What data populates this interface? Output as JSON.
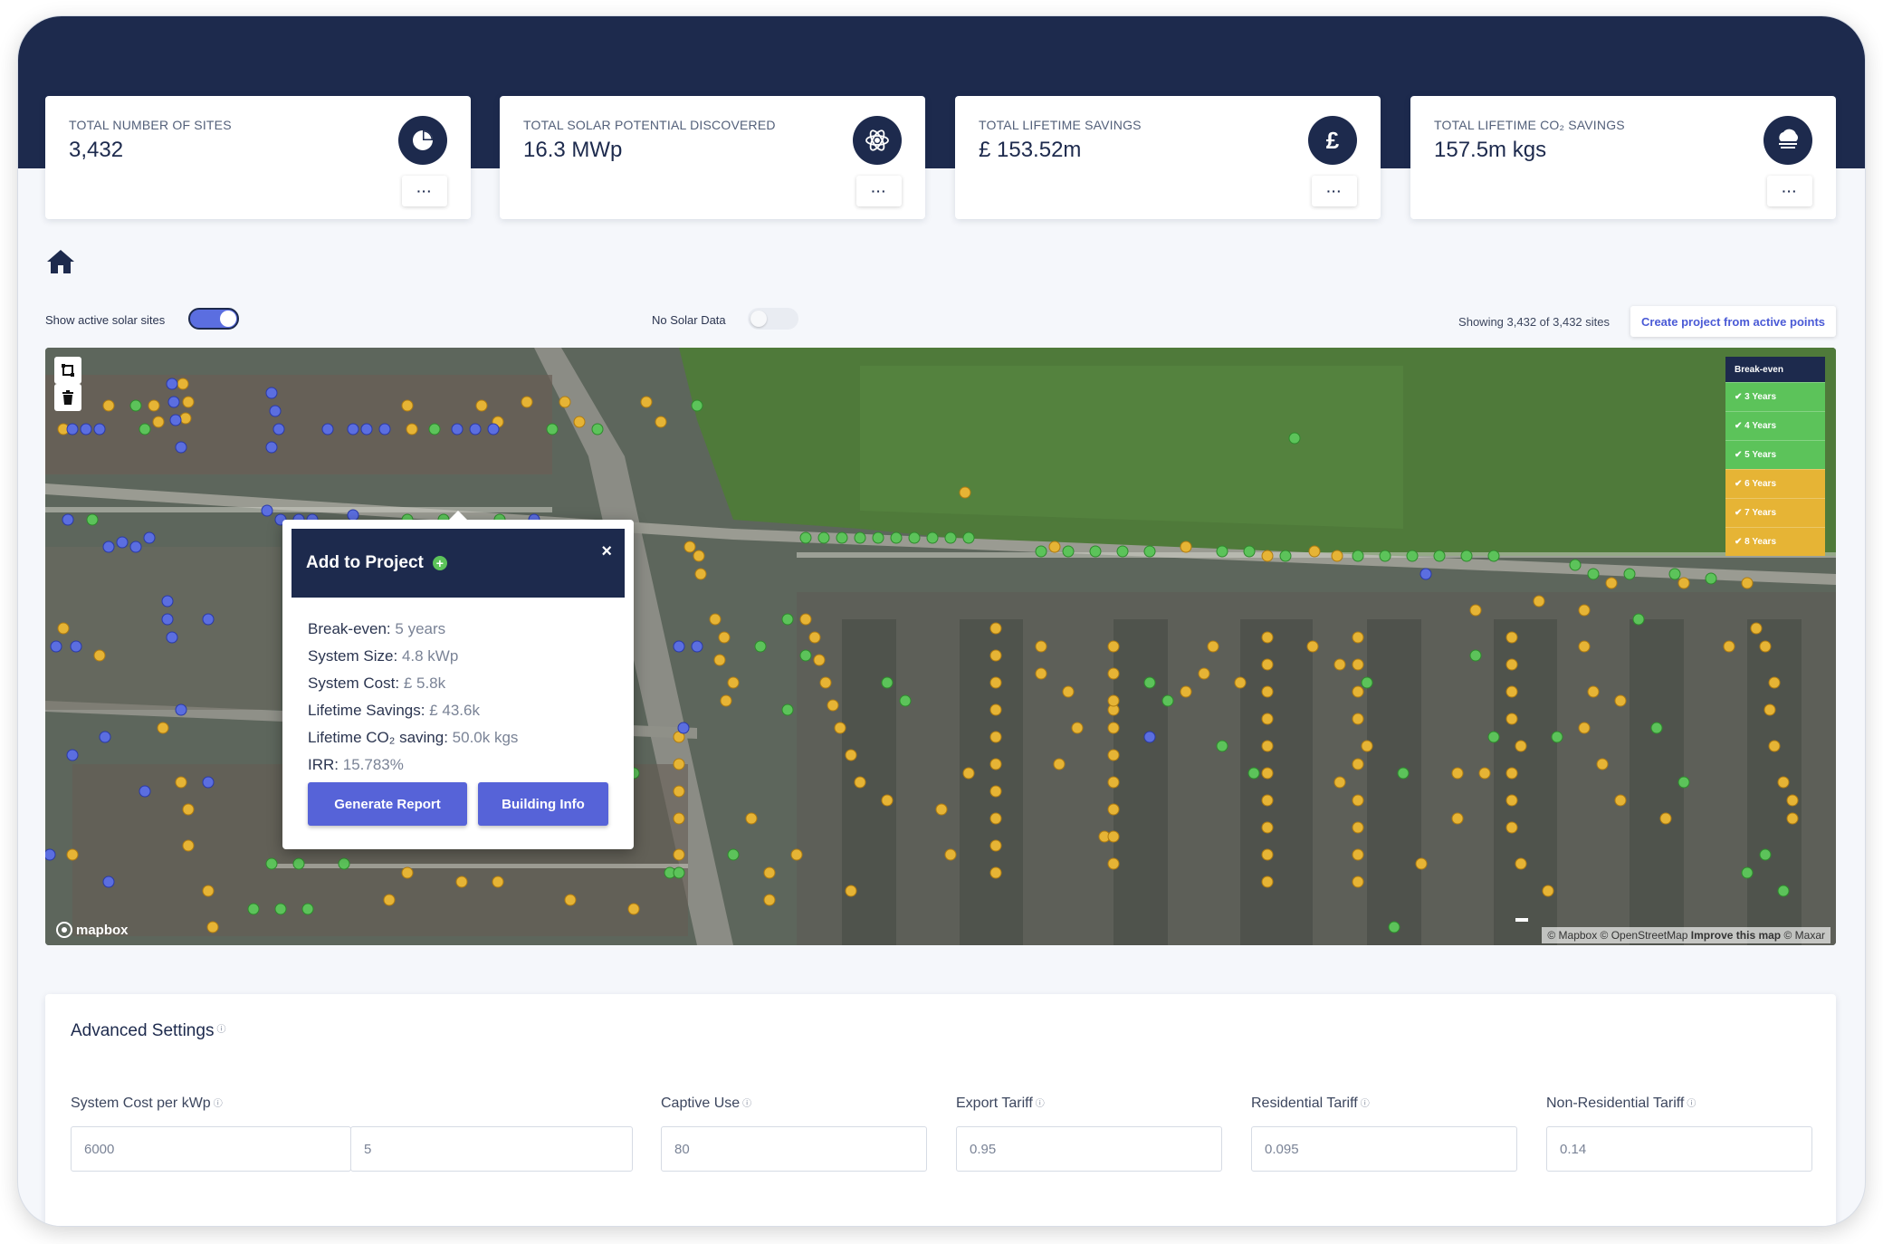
{
  "stats": [
    {
      "label": "TOTAL NUMBER OF SITES",
      "value": "3,432",
      "icon": "pie-chart-icon"
    },
    {
      "label": "TOTAL SOLAR POTENTIAL DISCOVERED",
      "value": "16.3 MWp",
      "icon": "atom-icon"
    },
    {
      "label": "TOTAL LIFETIME SAVINGS",
      "value": "£ 153.52m",
      "icon": "pound-icon",
      "glyph": "£"
    },
    {
      "label": "TOTAL LIFETIME CO₂ SAVINGS",
      "value": "157.5m kgs",
      "icon": "cloud-icon"
    }
  ],
  "more_label": "···",
  "toggles": {
    "active_sites_label": "Show active solar sites",
    "active_sites_on": true,
    "no_solar_label": "No Solar Data",
    "no_solar_on": false
  },
  "showing_text": "Showing 3,432 of 3,432 sites",
  "create_project_label": "Create project from active points",
  "colors": {
    "navy": "#1d2a4d",
    "accent": "#5663d8",
    "green": "#5cc35a",
    "amber": "#e6b435",
    "blue": "#5b6ee0"
  },
  "legend": {
    "title": "Break-even",
    "items": [
      {
        "label": "✔ 3 Years",
        "color": "#5cc35a"
      },
      {
        "label": "✔ 4 Years",
        "color": "#5cc35a"
      },
      {
        "label": "✔ 5 Years",
        "color": "#5cc35a"
      },
      {
        "label": "✔ 6 Years",
        "color": "#e6b435"
      },
      {
        "label": "✔ 7 Years",
        "color": "#e6b435"
      },
      {
        "label": "✔ 8 Years",
        "color": "#e6b435"
      }
    ]
  },
  "map": {
    "logo": "mapbox",
    "attribution_1": "© Mapbox © OpenStreetMap ",
    "attribution_2": "Improve this map",
    "attribution_3": " © Maxar"
  },
  "popup": {
    "title": "Add to Project",
    "close": "×",
    "rows": [
      {
        "label": "Break-even:",
        "value": "5 years"
      },
      {
        "label": "System Size:",
        "value": "4.8 kWp"
      },
      {
        "label": "System Cost:",
        "value": "£ 5.8k"
      },
      {
        "label": "Lifetime Savings:",
        "value": "£ 43.6k"
      },
      {
        "label": "Lifetime CO₂ saving:",
        "value": "50.0k kgs"
      },
      {
        "label": "IRR:",
        "value": "15.783%"
      }
    ],
    "generate_report": "Generate Report",
    "building_info": "Building Info"
  },
  "settings": {
    "title": "Advanced Settings",
    "fields": [
      {
        "label": "System Cost per kWp",
        "values": [
          "6000",
          "5"
        ]
      },
      {
        "label": "Captive Use",
        "values": [
          "80"
        ]
      },
      {
        "label": "Export Tariff",
        "values": [
          "0.95"
        ]
      },
      {
        "label": "Residential Tariff",
        "values": [
          "0.095"
        ]
      },
      {
        "label": "Non-Residential Tariff",
        "values": [
          "0.14"
        ]
      }
    ]
  }
}
